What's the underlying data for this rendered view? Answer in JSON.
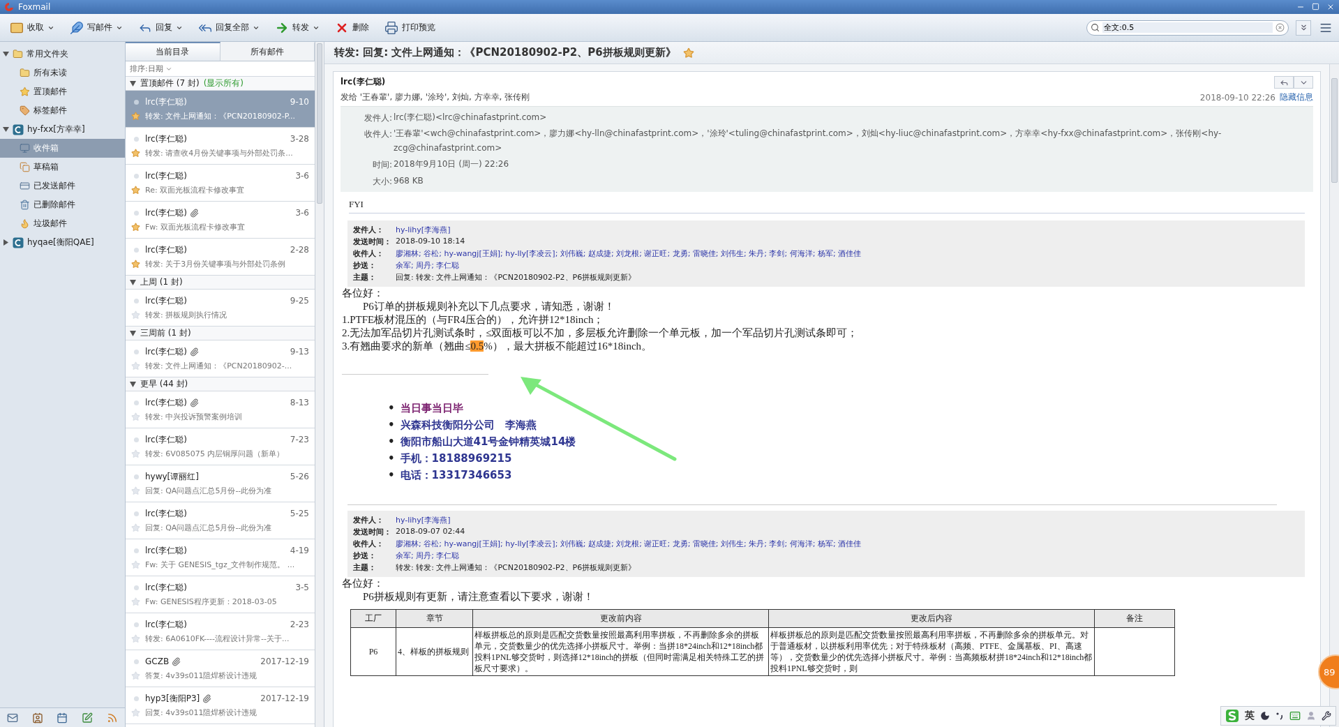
{
  "window": {
    "title": "Foxmail"
  },
  "toolbar": [
    {
      "label": "收取",
      "dropdown": true
    },
    {
      "label": "写邮件",
      "dropdown": true
    },
    {
      "label": "回复",
      "dropdown": true
    },
    {
      "label": "回复全部",
      "dropdown": true
    },
    {
      "label": "转发",
      "dropdown": true
    },
    {
      "label": "删除",
      "dropdown": false
    },
    {
      "label": "打印预览",
      "dropdown": false
    }
  ],
  "search": {
    "value": "全文:0.5"
  },
  "sidebar": {
    "items": [
      {
        "label": "常用文件夹",
        "expanded": true,
        "selected": false,
        "children": [
          {
            "label": "所有未读",
            "selected": false
          },
          {
            "label": "置顶邮件",
            "selected": false
          },
          {
            "label": "标签邮件",
            "selected": false
          }
        ]
      },
      {
        "label": "hy-fxx[方幸幸]",
        "expanded": true,
        "selected": false,
        "children": [
          {
            "label": "收件箱",
            "selected": true
          },
          {
            "label": "草稿箱",
            "selected": false
          },
          {
            "label": "已发送邮件",
            "selected": false
          },
          {
            "label": "已删除邮件",
            "selected": false
          },
          {
            "label": "垃圾邮件",
            "selected": false
          }
        ]
      },
      {
        "label": "hyqae[衡阳QAE]",
        "expanded": false,
        "selected": false
      }
    ]
  },
  "list_tabs": [
    {
      "label": "当前目录",
      "selected": true
    },
    {
      "label": "所有邮件",
      "selected": false
    }
  ],
  "sort": "排序:日期",
  "groups": [
    {
      "title": "置顶邮件 (7 封)",
      "link": "(显示所有)",
      "messages": [
        {
          "sender": "lrc(李仁聪)",
          "date": "9-10",
          "subject": "转发: 文件上网通知：《PCN20180902-P...",
          "starred": true,
          "attachment": false,
          "selected": true
        },
        {
          "sender": "lrc(李仁聪)",
          "date": "3-28",
          "subject": "转发: 请查收4月份关键事项与外部处罚条...",
          "starred": true,
          "attachment": false,
          "selected": false
        },
        {
          "sender": "lrc(李仁聪)",
          "date": "3-6",
          "subject": "Re: 双面光板流程卡修改事宜",
          "starred": true,
          "attachment": false,
          "selected": false
        },
        {
          "sender": "lrc(李仁聪)",
          "date": "3-6",
          "subject": "Fw: 双面光板流程卡修改事宜",
          "starred": true,
          "attachment": true,
          "selected": false
        },
        {
          "sender": "lrc(李仁聪)",
          "date": "2-28",
          "subject": "转发: 关于3月份关键事项与外部处罚条例",
          "starred": true,
          "attachment": false,
          "selected": false
        }
      ]
    },
    {
      "title": "上周 (1 封)",
      "messages": [
        {
          "sender": "lrc(李仁聪)",
          "date": "9-25",
          "subject": "转发: 拼板规则执行情况",
          "starred": false,
          "attachment": false,
          "selected": false
        }
      ]
    },
    {
      "title": "三周前 (1 封)",
      "messages": [
        {
          "sender": "lrc(李仁聪)",
          "date": "9-13",
          "subject": "转发: 文件上网通知：《PCN20180902-...",
          "starred": false,
          "attachment": true,
          "selected": false
        }
      ]
    },
    {
      "title": "更早 (44 封)",
      "messages": [
        {
          "sender": "lrc(李仁聪)",
          "date": "8-13",
          "subject": "转发: 中兴投诉预警案例培训",
          "starred": false,
          "attachment": true,
          "selected": false
        },
        {
          "sender": "lrc(李仁聪)",
          "date": "7-23",
          "subject": "转发: 6V085075 内层铜厚问题（新单）",
          "starred": false,
          "attachment": false,
          "selected": false
        },
        {
          "sender": "hywy[谭丽红]",
          "date": "5-26",
          "subject": "回复: QA问题点汇总5月份--此份为准",
          "starred": false,
          "attachment": false,
          "selected": false
        },
        {
          "sender": "lrc(李仁聪)",
          "date": "5-25",
          "subject": "回复: QA问题点汇总5月份--此份为准",
          "starred": false,
          "attachment": false,
          "selected": false
        },
        {
          "sender": "lrc(李仁聪)",
          "date": "4-19",
          "subject": "Fw: 关于 GENESIS_tgz_文件制作规范。 ...",
          "starred": false,
          "attachment": false,
          "selected": false
        },
        {
          "sender": "lrc(李仁聪)",
          "date": "3-5",
          "subject": "Fw: GENESIS程序更新：2018-03-05",
          "starred": false,
          "attachment": false,
          "selected": false
        },
        {
          "sender": "lrc(李仁聪)",
          "date": "2-23",
          "subject": "转发: 6A0610FK----流程设计异常--关于...",
          "starred": false,
          "attachment": false,
          "selected": false
        },
        {
          "sender": "GCZB",
          "date": "2017-12-19",
          "subject": "答复: 4v39s011阻焊桥设计违规",
          "starred": false,
          "attachment": true,
          "selected": false
        },
        {
          "sender": "hyp3[衡阳P3]",
          "date": "2017-12-19",
          "subject": "回复: 4v39s011阻焊桥设计违规",
          "starred": false,
          "attachment": true,
          "selected": false
        }
      ]
    }
  ],
  "message": {
    "subject": "转发: 回复: 文件上网通知：《PCN20180902-P2、P6拼板规则更新》",
    "starred": true,
    "from": "lrc(李仁聪)",
    "to_line": "发给 '王春輩', 廖力娜, '涂玲', 刘灿, 方幸幸, 张传刚",
    "date": "2018-09-10 22:26",
    "hide_link": "隐藏信息",
    "details": [
      {
        "label": "发件人:",
        "value": "lrc(李仁聪)<lrc@chinafastprint.com>"
      },
      {
        "label": "收件人:",
        "value": "'王春輩'<wch@chinafastprint.com>，廖力娜<hy-lln@chinafastprint.com>，'涂玲'<tuling@chinafastprint.com>，刘灿<hy-liuc@chinafastprint.com>，方幸幸<hy-fxx@chinafastprint.com>，张传刚<hy-zcg@chinafastprint.com>"
      },
      {
        "label": "时间:",
        "value": "2018年9月10日 (周一) 22:26"
      },
      {
        "label": "大小:",
        "value": "968 KB"
      }
    ],
    "intro": "FYI",
    "quotes": [
      {
        "fields": [
          {
            "label": "发件人：",
            "value": "hy-lihy[李海燕]",
            "kind": "link"
          },
          {
            "label": "发送时间：",
            "value": "2018-09-10 18:14",
            "kind": "text"
          },
          {
            "label": "收件人：",
            "value": "廖湘林; 谷松; hy-wangj[王娟]; hy-lly[李凌云]; 刘伟巍; 赵成捷; 刘龙根; 谢正旺; 龙勇; 雷晓佳; 刘伟生; 朱丹; 李剑; 何海洋; 杨军; 酒佳佳",
            "kind": "link"
          },
          {
            "label": "抄送：",
            "value": "余军; 周丹; 李仁聪",
            "kind": "link"
          },
          {
            "label": "主题：",
            "value": "回复: 转发: 文件上网通知：《PCN20180902-P2、P6拼板规则更新》",
            "kind": "text"
          }
        ],
        "greeting": "各位好：",
        "lead": "P6订单的拼板规则补充以下几点要求，请知悉，谢谢！",
        "lines": [
          {
            "text": "1.PTFE板材混压的（与FR4压合的），允许拼12*18inch；"
          },
          {
            "text": "2.无法加军品切片孔测试条时，≤双面板可以不加，多层板允许删除一个单元板，加一个军品切片孔测试条即可；"
          },
          {
            "text": "3.有翘曲要求的新单（翘曲≤",
            "highlight": "0.5",
            "after": "%），最大拼板不能超过16*18inch。"
          }
        ],
        "signature": [
          {
            "bullet": "•",
            "text": "当日事当日毕",
            "color": "#7a1f6e"
          },
          {
            "bullet": "•",
            "text": "兴森科技衡阳分公司　李海燕",
            "color": "#2e3590"
          },
          {
            "bullet": "•",
            "text": "衡阳市船山大道41号金钟精英城14楼",
            "color": "#2e3590"
          },
          {
            "bullet": "•",
            "text": "手机：18188969215",
            "color": "#2e3590"
          },
          {
            "bullet": "•",
            "text": "电话：13317346653",
            "color": "#2e3590"
          }
        ]
      },
      {
        "fields": [
          {
            "label": "发件人：",
            "value": "hy-lihy[李海燕]",
            "kind": "link"
          },
          {
            "label": "发送时间：",
            "value": "2018-09-07 02:44",
            "kind": "text"
          },
          {
            "label": "收件人：",
            "value": "廖湘林; 谷松; hy-wangj[王娟]; hy-lly[李凌云]; 刘伟巍; 赵成捷; 刘龙根; 谢正旺; 龙勇; 雷晓佳; 刘伟生; 朱丹; 李剑; 何海洋; 杨军; 酒佳佳",
            "kind": "link"
          },
          {
            "label": "抄送：",
            "value": "余军; 周丹; 李仁聪",
            "kind": "link"
          },
          {
            "label": "主题：",
            "value": "转发: 转发: 文件上网通知：《PCN20180902-P2、P6拼板规则更新》",
            "kind": "text"
          }
        ],
        "greeting": "各位好：",
        "lead": "P6拼板规则有更新，请注意查看以下要求，谢谢！",
        "table": {
          "columns": [
            "工厂",
            "章节",
            "更改前内容",
            "更改后内容",
            "备注"
          ],
          "rows": [
            [
              "P6",
              "4、样板的拼板规则",
              "样板拼板总的原则是匹配交货数量按照最高利用率拼板，不再删除多余的拼板单元，交货数量少的优先选择小拼板尺寸。举例：当拼18*24inch和12*18inch都投料1PNL够交货时，则选择12*18inch的拼板（但同时需满足相关特殊工艺的拼板尺寸要求）。",
              "样板拼板总的原则是匹配交货数量按照最高利用率拼板，不再删除多余的拼板单元。对于普通板材，以拼板利用率优先；对于特殊板材（高频、PTFE、金属基板、PI、高速等），交货数量少的优先选择小拼板尺寸。举例：当高频板材拼18*24inch和12*18inch都投料1PNL够交货时，则",
              ""
            ]
          ]
        }
      }
    ]
  },
  "badge": "89",
  "ime": {
    "label": "英"
  }
}
